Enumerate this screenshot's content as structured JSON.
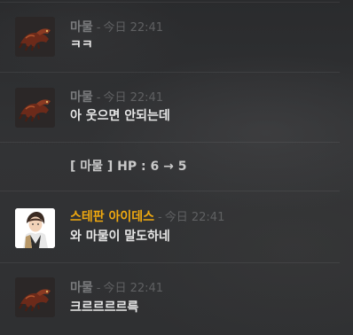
{
  "messages": [
    {
      "author": "마물",
      "separator": "-",
      "time": "今日 22:41",
      "text": "ㅋㅋ",
      "avatar": "monster-avatar"
    },
    {
      "author": "마물",
      "separator": "-",
      "time": "今日 22:41",
      "text": "아 웃으면 안되는데",
      "avatar": "monster-avatar"
    },
    {
      "text": "[ 마물 ] HP : 6 → 5"
    },
    {
      "author": "스테판 아이데스",
      "separator": "-",
      "time": "今日 22:41",
      "text": "와 마물이 말도하네",
      "avatar": "character-avatar",
      "author_color": "#f0a90f"
    },
    {
      "author": "마물",
      "separator": "-",
      "time": "今日 22:41",
      "text": "크르르르르륵",
      "avatar": "monster-avatar"
    }
  ],
  "colors": {
    "background": "#2c2d2f",
    "author": "#7a7b7d",
    "author_highlight": "#f0a90f",
    "timestamp": "#5f6062",
    "message_text": "#e6e6e6"
  }
}
